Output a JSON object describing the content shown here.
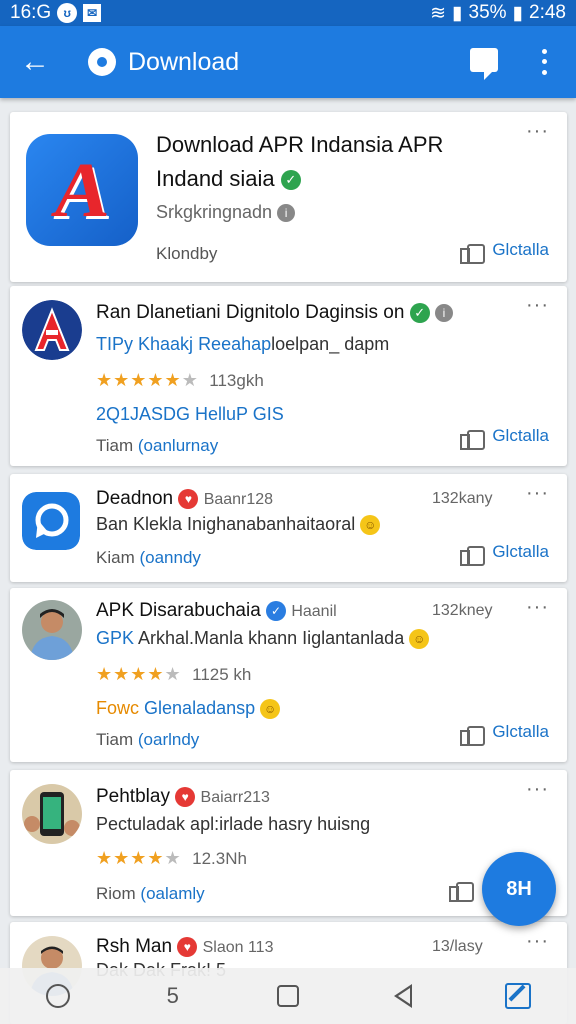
{
  "status": {
    "time_left": "16:G",
    "battery": "35%",
    "time_right": "2:48"
  },
  "appbar": {
    "title": "Download"
  },
  "hero": {
    "title_line1": "Download APR Indansia APR",
    "title_line2": "Indand siaia",
    "developer": "Srkgkringnadn",
    "footer": "Klondby",
    "like_label": "Glctalla"
  },
  "posts": [
    {
      "title": "Ran Dlanetiani Dignitolo Daginsis on",
      "subtitle_blue": "TIPy Khaakj",
      "subtitle_blue2": "Reeahap",
      "subtitle_rest": "loelpan_ dapm",
      "rating": "113gkh",
      "extra": "2Q1JASDG HelluP GIS",
      "footer_a": "Tiam",
      "footer_b": "(oanlurnay",
      "like_label": "Glctalla"
    },
    {
      "title": "Deadnon",
      "meta": "Baanr128",
      "time": "132kany",
      "body": "Ban Klekla Inighanabanhaitaoral",
      "footer_a": "Kiam",
      "footer_b": "(oanndy",
      "like_label": "Glctalla"
    },
    {
      "title": "APK Disarabuchaia",
      "meta": "Haanil",
      "time": "132kney",
      "body_blue": "GPK",
      "body": "Arkhal.Manla khann Iiglantanlada",
      "rating": "1125 kh",
      "extra_orange": "Fowc",
      "extra_blue": "Glenaladansp",
      "footer_a": "Tiam",
      "footer_b": "(oarlndy",
      "like_label": "Glctalla"
    },
    {
      "title": "Pehtblay",
      "meta": "Baiarr213",
      "body": "Pectuladak apl:irlade hasry huisng",
      "rating": "12.3Nh",
      "footer_a": "Riom",
      "footer_b": "(oalamly"
    },
    {
      "title": "Rsh Man",
      "meta": "Slaon 113",
      "time": "13/lasy",
      "body": "Dak Dak Frak! 5"
    }
  ],
  "fab": {
    "label": "8H"
  },
  "navbar": {
    "count": "5"
  },
  "colors": {
    "primary": "#1e7be0",
    "status_bar": "#1565c0",
    "link_blue": "#1a73c8",
    "star": "#f0a020",
    "verified_green": "#2ea44f"
  }
}
